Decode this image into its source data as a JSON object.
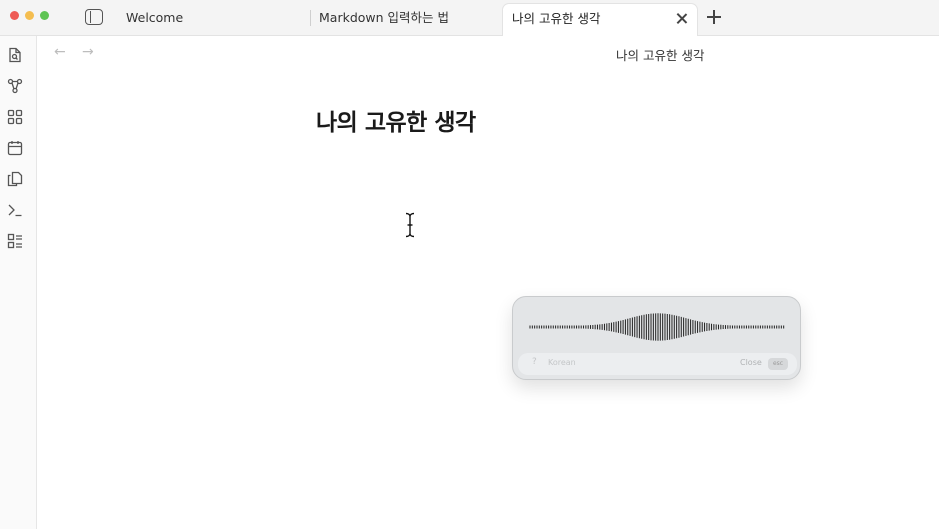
{
  "tabs": {
    "welcome": "Welcome",
    "markdown": "Markdown 입력하는 법",
    "active": "나의 고유한 생각"
  },
  "view": {
    "title": "나의 고유한 생각"
  },
  "document": {
    "heading": "나의 고유한 생각"
  },
  "ribbon": {
    "icons": [
      "search-file-icon",
      "graph-icon",
      "blocks-icon",
      "calendar-icon",
      "copy-icon",
      "terminal-icon",
      "checklist-icon"
    ]
  },
  "dictation": {
    "hint_key": "?",
    "hint": "Korean",
    "close_label": "Close",
    "esc_label": "esc"
  },
  "colors": {
    "traffic_red": "#ee5b55",
    "traffic_yellow": "#f4bd4f",
    "traffic_green": "#5fc454"
  }
}
